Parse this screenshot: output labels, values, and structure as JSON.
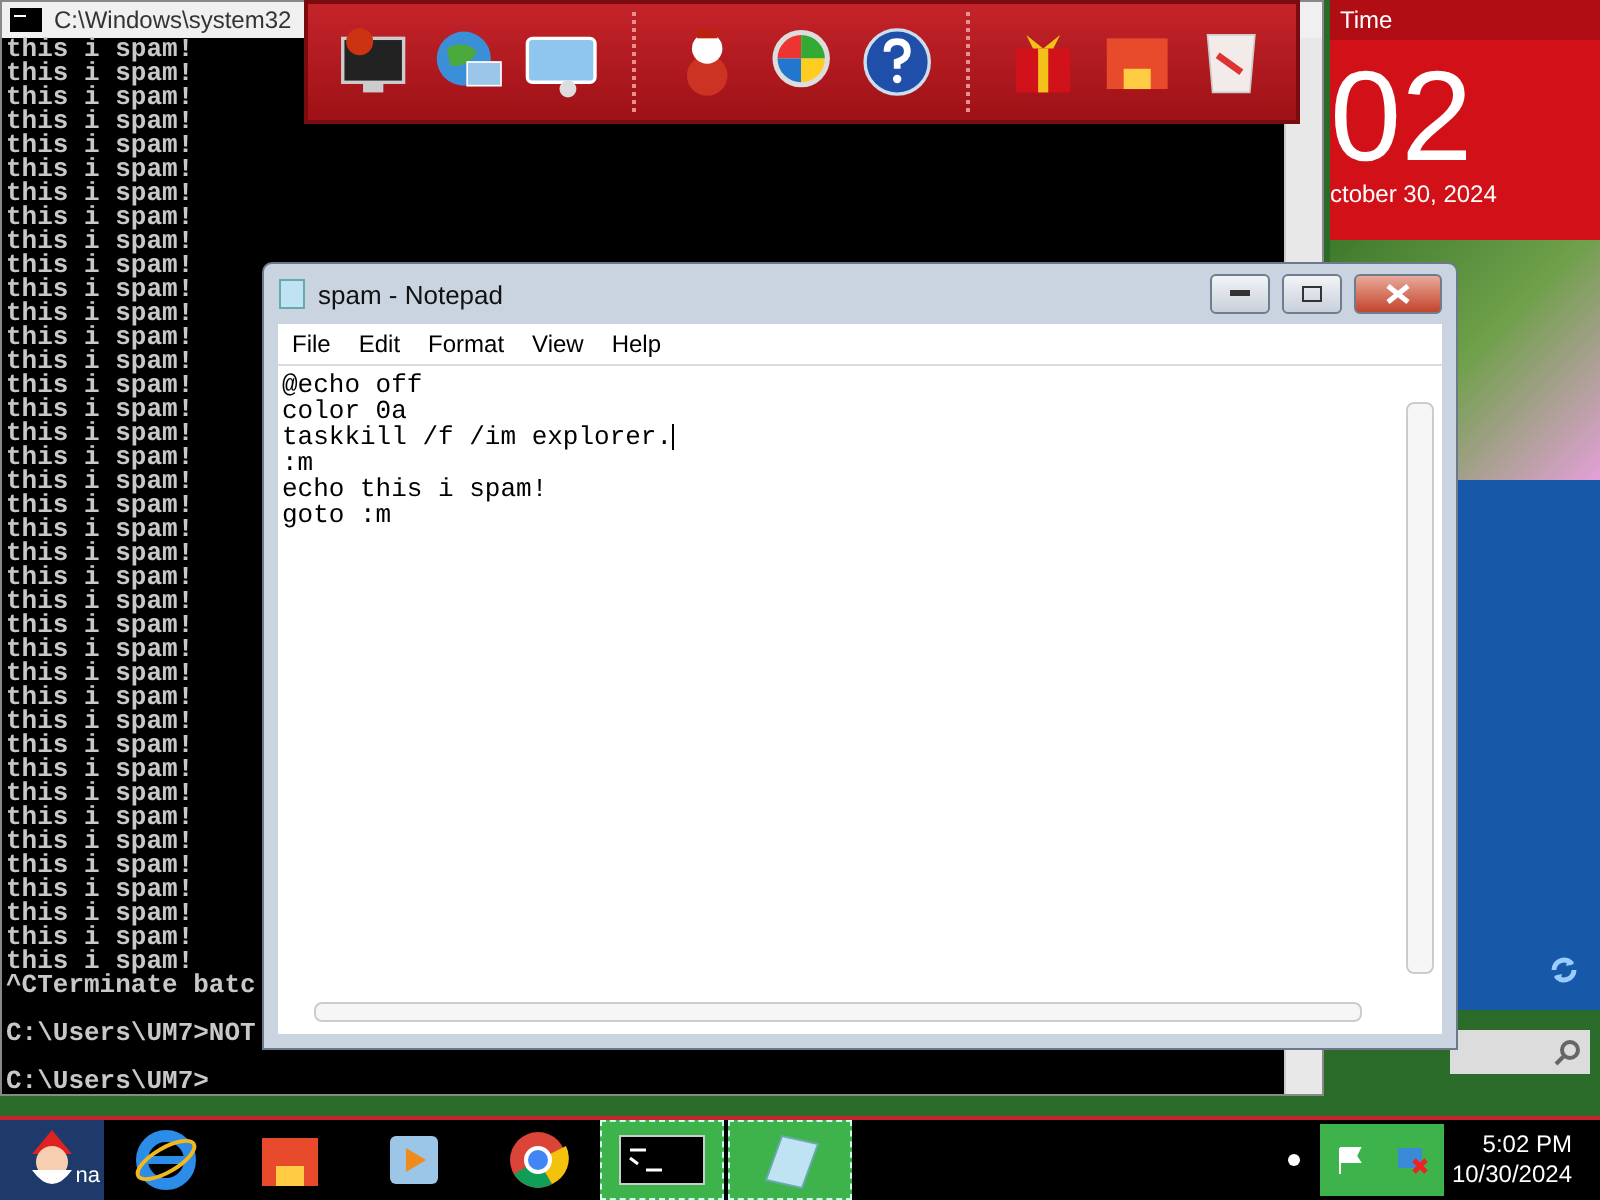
{
  "console": {
    "title": "C:\\Windows\\system32",
    "lines": [
      "this i spam!",
      "this i spam!",
      "this i spam!",
      "this i spam!",
      "this i spam!",
      "this i spam!",
      "this i spam!",
      "this i spam!",
      "this i spam!",
      "this i spam!",
      "this i spam!",
      "this i spam!",
      "this i spam!",
      "this i spam!",
      "this i spam!",
      "this i spam!",
      "this i spam!",
      "this i spam!",
      "this i spam!",
      "this i spam!",
      "this i spam!",
      "this i spam!",
      "this i spam!",
      "this i spam!",
      "this i spam!",
      "this i spam!",
      "this i spam!",
      "this i spam!",
      "this i spam!",
      "this i spam!",
      "this i spam!",
      "this i spam!",
      "this i spam!",
      "this i spam!",
      "this i spam!",
      "this i spam!",
      "this i spam!",
      "this i spam!",
      "this i spam!",
      "^CTerminate batc"
    ],
    "prompts": [
      "C:\\Users\\UM7>NOT",
      "C:\\Users\\UM7>"
    ]
  },
  "dock": {
    "groups": [
      {
        "items": [
          {
            "kind": "monitor"
          },
          {
            "kind": "globe"
          },
          {
            "kind": "control-panel"
          }
        ]
      },
      {
        "items": [
          {
            "kind": "snowman"
          },
          {
            "kind": "shield"
          },
          {
            "kind": "help"
          }
        ]
      },
      {
        "items": [
          {
            "kind": "gift"
          },
          {
            "kind": "folder"
          },
          {
            "kind": "trash"
          }
        ]
      }
    ]
  },
  "clock_tile": {
    "header": "Time",
    "time": "02",
    "date": "ctober 30, 2024"
  },
  "notepad": {
    "title": "spam - Notepad",
    "menu": [
      "File",
      "Edit",
      "Format",
      "View",
      "Help"
    ],
    "lines": [
      "@echo off",
      "color 0a",
      "taskkill /f /im explorer.",
      ":m",
      "echo this i spam!",
      "goto :m"
    ]
  },
  "taskbar": {
    "items": [
      {
        "kind": "start",
        "active": false
      },
      {
        "kind": "ie",
        "active": false
      },
      {
        "kind": "folder",
        "active": false
      },
      {
        "kind": "media",
        "active": false
      },
      {
        "kind": "chrome",
        "active": false
      },
      {
        "kind": "cmd",
        "active": true
      },
      {
        "kind": "notepad",
        "active": true
      }
    ],
    "start_label": "na",
    "time": "5:02 PM",
    "date": "10/30/2024"
  }
}
